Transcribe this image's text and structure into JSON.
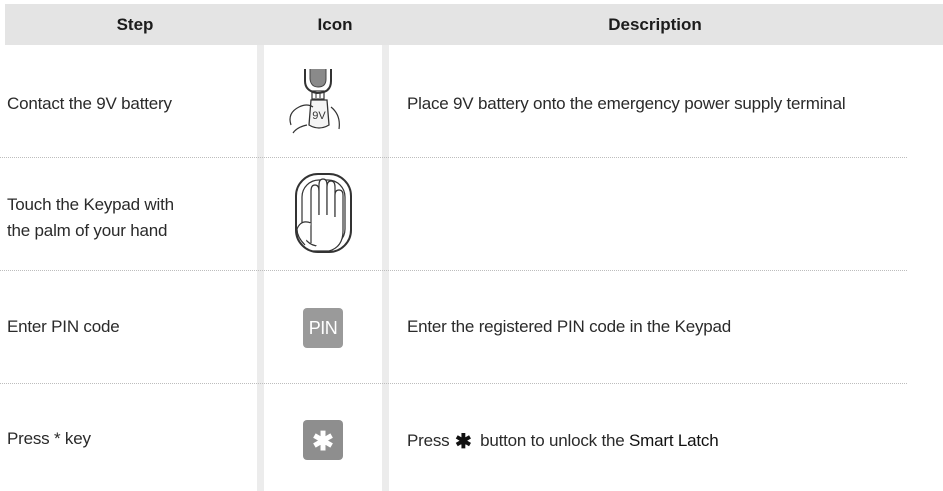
{
  "table": {
    "headers": {
      "step": "Step",
      "icon": "Icon",
      "description": "Description"
    },
    "rows": [
      {
        "step": "Contact the 9V battery",
        "icon": "battery-9v-hand-icon",
        "icon_label": "9V",
        "description": "Place 9V battery onto the emergency power supply terminal"
      },
      {
        "step_line1": "Touch the Keypad with",
        "step_line2": "the palm of your hand",
        "icon": "palm-on-keypad-icon",
        "description": ""
      },
      {
        "step": "Enter PIN code",
        "icon": "pin-code-icon",
        "icon_label": "PIN",
        "description": "Enter the registered PIN code in the Keypad"
      },
      {
        "step": "Press * key",
        "icon": "star-key-icon",
        "icon_label": "✱",
        "description_before": "Press",
        "description_symbol": "✱",
        "description_middle": "button to unlock the",
        "description_emphasis": "Smart Latch"
      }
    ]
  },
  "colors": {
    "header_bg": "#e4e4e4",
    "column_separator": "#ececec",
    "badge_gray": "#8e8e8e",
    "dotted_rule": "#bdbdbd"
  }
}
